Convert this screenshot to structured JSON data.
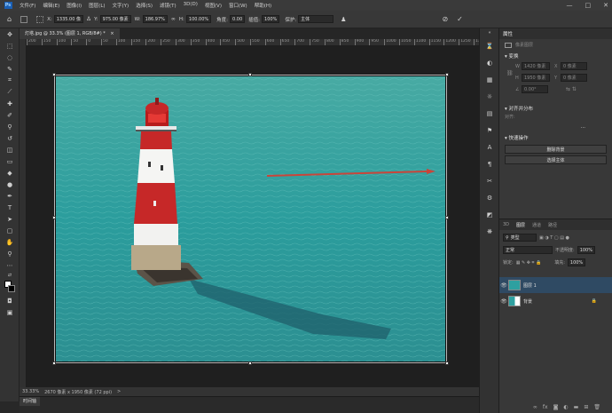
{
  "menu": {
    "logo": "Ps",
    "items": [
      "文件(F)",
      "编辑(E)",
      "图像(I)",
      "图层(L)",
      "文字(Y)",
      "选择(S)",
      "滤镜(T)",
      "3D(D)",
      "视图(V)",
      "窗口(W)",
      "帮助(H)"
    ],
    "window_controls": [
      "—",
      "□",
      "✕"
    ]
  },
  "options": {
    "x_label": "X:",
    "x_value": "1335.00 像",
    "y_label": "Y:",
    "y_value": "975.00 像素",
    "w_label": "W:",
    "w_value": "186.97%",
    "h_label": "H:",
    "h_value": "100.00%",
    "angle_label": "角度:",
    "angle_value": "0.00",
    "interp_label": "插值:",
    "interp_value": "100%",
    "protect_label": "保护:",
    "protect_value": "主体",
    "cancel_icon": "cancel-icon",
    "commit_icon": "checkmark-icon"
  },
  "document": {
    "tab_label": "灯塔.jpg @ 33.3% (图层 1, RGB/8#) *",
    "tab_close": "×",
    "ruler_ticks": [
      "200",
      "150",
      "100",
      "50",
      "0",
      "50",
      "100",
      "150",
      "200",
      "250",
      "300",
      "350",
      "400",
      "450",
      "500",
      "550",
      "600",
      "650",
      "700",
      "750",
      "800",
      "850",
      "900",
      "950",
      "1000",
      "1050",
      "1100",
      "1150",
      "1200",
      "1250",
      "1300",
      "1350",
      "1400",
      "1450",
      "1500",
      "1550",
      "1600",
      "1650",
      "1700",
      "1750",
      "1800",
      "1850",
      "1900",
      "1950",
      "2000",
      "2050",
      "2100",
      "2150",
      "2200",
      "2250",
      "2300",
      "2350",
      "2400",
      "2450",
      "2500",
      "2550",
      "2600",
      "2650",
      "2700",
      "2750",
      "2800"
    ]
  },
  "status": {
    "zoom": "33.33%",
    "doc_info": "2670 像素 x 1950 像素 (72 ppi)",
    "arrow": ">"
  },
  "timeline": {
    "label": "时间轴"
  },
  "properties": {
    "title": "属性",
    "pixel_layer": "像素图层",
    "transform_title": "变换",
    "w_label": "W",
    "w_value": "1420 像素",
    "x_label": "X",
    "x_value": "0 像素",
    "h_label": "H",
    "h_value": "1950 像素",
    "y_label": "Y",
    "y_value": "0 像素",
    "angle_value": "0.00°",
    "align_title": "对齐并分布",
    "align_sub": "对齐:",
    "more": "...",
    "quick_title": "快速操作",
    "quick_btn1": "删除背景",
    "quick_btn2": "选择主体"
  },
  "layers": {
    "tabs": [
      "3D",
      "图层",
      "通道",
      "路径"
    ],
    "kind_label": "类型",
    "blend_mode": "正常",
    "opacity_label": "不透明度:",
    "opacity_value": "100%",
    "lock_label": "锁定:",
    "fill_label": "填充:",
    "fill_value": "100%",
    "rows": [
      {
        "name": "图层 1",
        "selected": true
      },
      {
        "name": "背景",
        "selected": false
      }
    ],
    "footer_icons": [
      "link-icon",
      "fx-icon",
      "mask-icon",
      "adjustment-icon",
      "folder-icon",
      "new-layer-icon",
      "trash-icon"
    ]
  },
  "colors": {
    "accent": "#2f4a63",
    "water": "#2ea0a0",
    "lighthouse_red": "#c62828",
    "arrow_red": "#c9453a"
  }
}
